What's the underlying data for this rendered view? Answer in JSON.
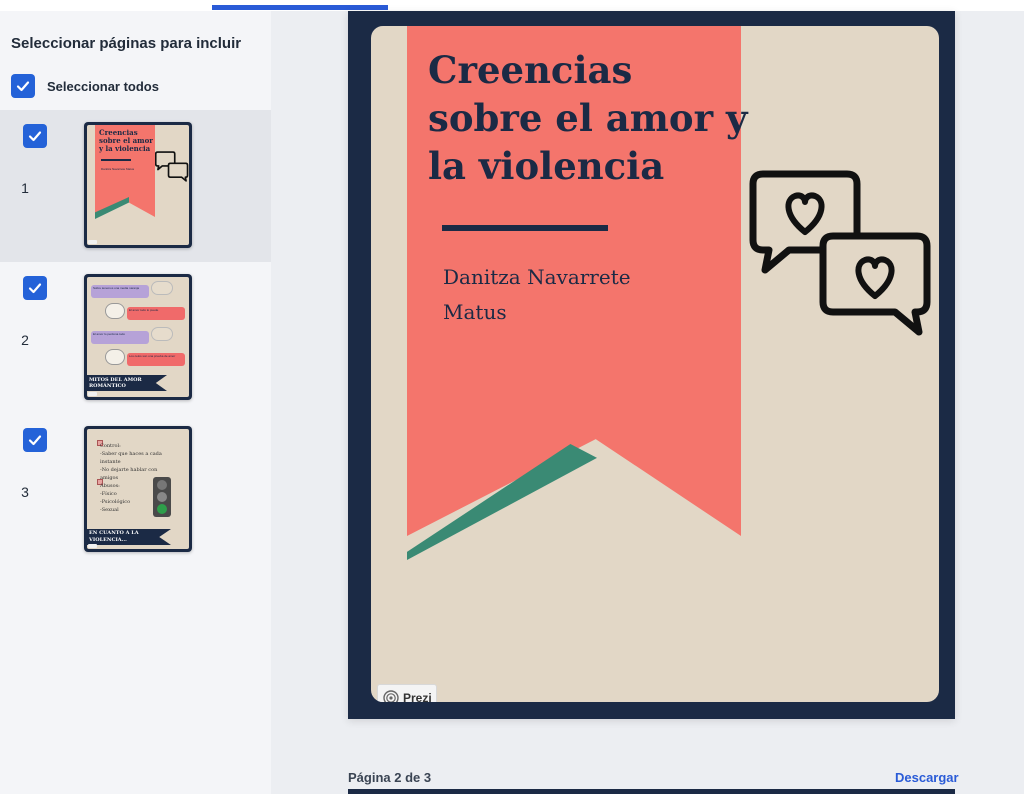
{
  "sidebar": {
    "title": "Seleccionar páginas para incluir",
    "select_all_label": "Seleccionar todos",
    "pages": [
      {
        "number": "1",
        "checked": true,
        "thumb_title": "Creencias sobre el amor y la violencia",
        "thumb_author": "Danitza Navarrete Matus"
      },
      {
        "number": "2",
        "checked": true,
        "thumb_items": [
          "Sobre tenemos una media naranja",
          "El amor todo lo puede",
          "El amor lo perdona todo",
          "Los celos son una prueba de amor"
        ],
        "thumb_footer": "MITOS DEL AMOR ROMÁNTICO"
      },
      {
        "number": "3",
        "checked": true,
        "thumb_lines": [
          "Control:",
          "-Saber que haces a cada instante",
          "-No dejarte hablar con amigos",
          "Abusos:",
          "-Físico",
          "-Psicológico",
          "-Sexual"
        ],
        "thumb_footer": "EN CUANTO A LA VIOLENCIA..."
      }
    ]
  },
  "slide": {
    "title": "Creencias sobre el amor y la violencia",
    "author": "Danitza Navarrete Matus",
    "icon": "heart-chat-bubbles-icon",
    "badge_label": "Prezi"
  },
  "footer": {
    "page_counter": "Página 2 de 3",
    "download_label": "Descargar"
  },
  "colors": {
    "accent": "#2462d8",
    "navy": "#1b2a45",
    "coral": "#f4756c",
    "teal": "#3a8a74",
    "beige": "#e2d7c6"
  }
}
